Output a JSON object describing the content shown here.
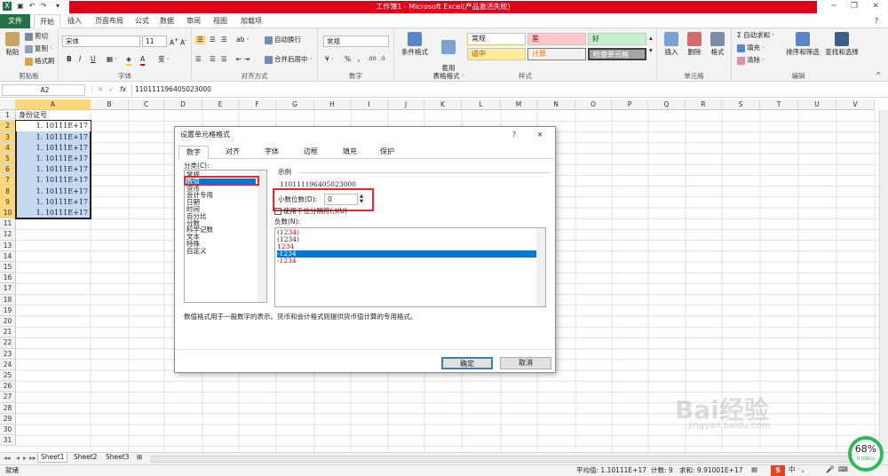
{
  "window": {
    "title": "工作簿1 - Microsoft Excel(产品激活失败)"
  },
  "tabs": [
    "文件",
    "开始",
    "插入",
    "页面布局",
    "公式",
    "数据",
    "审阅",
    "视图",
    "加载项"
  ],
  "ribbon": {
    "clipboard": {
      "paste": "粘贴",
      "cut": "剪切",
      "copy": "复制 ·",
      "format_painter": "格式刷",
      "label": "剪贴板"
    },
    "font": {
      "name": "宋体",
      "size": "11",
      "bold": "B",
      "italic": "I",
      "underline": "U",
      "label": "字体"
    },
    "alignment": {
      "wrap": "自动换行",
      "merge": "合并后居中 ·",
      "label": "对齐方式"
    },
    "number": {
      "format": "常规",
      "percent": "%",
      "comma": "，",
      "label": "数字"
    },
    "styles": {
      "conditional": "条件格式",
      "table": "套用\n表格格式 ·",
      "normal": "常规",
      "bad": "差",
      "good": "好",
      "neutral": "适中",
      "calc": "计算",
      "check": "检查单元格",
      "label": "样式"
    },
    "cells": {
      "insert": "插入",
      "delete": "删除",
      "format": "格式",
      "label": "单元格"
    },
    "editing": {
      "autosum": "Σ 自动求和 ·",
      "fill": "填充 ·",
      "clear": "清除 ·",
      "sort": "排序和筛选",
      "find": "查找和选择",
      "label": "编辑"
    }
  },
  "formula_bar": {
    "name_box": "A2",
    "fx": "fx",
    "value": "110111196405023000"
  },
  "columns": [
    "A",
    "B",
    "C",
    "D",
    "E",
    "F",
    "G",
    "H",
    "I",
    "J",
    "K",
    "L",
    "M",
    "N",
    "O",
    "P",
    "Q",
    "R",
    "S",
    "T",
    "U",
    "V"
  ],
  "rows": [
    "1",
    "2",
    "3",
    "4",
    "5",
    "6",
    "7",
    "8",
    "9",
    "10",
    "11",
    "12",
    "13",
    "14",
    "15",
    "16",
    "17",
    "18",
    "19",
    "20",
    "21",
    "22",
    "23",
    "24",
    "25",
    "26",
    "27",
    "28",
    "29",
    "30",
    "31"
  ],
  "cells": {
    "a1": "身份证号",
    "a_values": [
      "1. 10111E+17",
      "1. 10111E+17",
      "1. 10111E+17",
      "1. 10111E+17",
      "1. 10111E+17",
      "1. 10111E+17",
      "1. 10111E+17",
      "1. 10111E+17",
      "1. 10111E+17"
    ]
  },
  "sheets": [
    "Sheet1",
    "Sheet2",
    "Sheet3"
  ],
  "status": {
    "ready": "就绪",
    "average": "平均值: 1.10111E+17",
    "count": "计数: 9",
    "sum": "求和: 9.91001E+17",
    "zoom": "68%",
    "speed": "0.09K/s"
  },
  "watermark": {
    "brand": "Bai经验",
    "url": "jingyan.baidu.com"
  },
  "dialog": {
    "title": "设置单元格格式",
    "help": "?",
    "close": "✕",
    "tabs": [
      "数字",
      "对齐",
      "字体",
      "边框",
      "填充",
      "保护"
    ],
    "category_label": "分类(C):",
    "categories": [
      "常规",
      "数值",
      "货币",
      "会计专用",
      "日期",
      "时间",
      "百分比",
      "分数",
      "科学记数",
      "文本",
      "特殊",
      "自定义"
    ],
    "sample_label": "示例",
    "sample_value": "110111196405023000",
    "decimal_label": "小数位数(D):",
    "decimal_value": "0",
    "thousand_sep": "使用千位分隔符(,)(U)",
    "negative_label": "负数(N):",
    "negatives": [
      "(1234)",
      "(1234)",
      "1234",
      "-1234",
      "-1234"
    ],
    "description": "数值格式用于一般数字的表示。货币和会计格式则提供货币值计算的专用格式。",
    "ok": "确定",
    "cancel": "取消"
  }
}
